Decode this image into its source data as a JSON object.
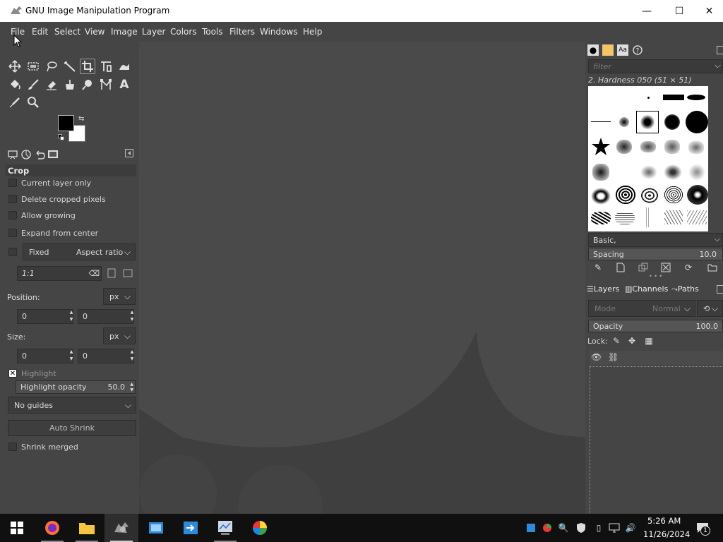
{
  "window": {
    "title": "GNU Image Manipulation Program",
    "minimize": "—",
    "maximize": "☐",
    "close": "✕"
  },
  "menubar": {
    "items": [
      "File",
      "Edit",
      "Select",
      "View",
      "Image",
      "Layer",
      "Colors",
      "Tools",
      "Filters",
      "Windows",
      "Help"
    ]
  },
  "tool_options": {
    "title": "Crop",
    "current_layer_only": "Current layer only",
    "delete_cropped": "Delete cropped pixels",
    "allow_growing": "Allow growing",
    "expand_from_center": "Expand from center",
    "fixed_label": "Fixed",
    "fixed_mode": "Aspect ratio",
    "ratio_value": "1:1",
    "position_label": "Position:",
    "position_unit": "px",
    "position_x": "0",
    "position_y": "0",
    "size_label": "Size:",
    "size_unit": "px",
    "size_w": "0",
    "size_h": "0",
    "highlight": "Highlight",
    "highlight_opacity_label": "Highlight opacity",
    "highlight_opacity_value": "50.0",
    "guides": "No guides",
    "auto_shrink": "Auto Shrink",
    "shrink_merged": "Shrink merged"
  },
  "brushes": {
    "filter_placeholder": "filter",
    "selected_brush": "2. Hardness 050 (51 × 51)",
    "tag": "Basic,",
    "spacing_label": "Spacing",
    "spacing_value": "10.0"
  },
  "layers": {
    "tab_layers": "Layers",
    "tab_channels": "Channels",
    "tab_paths": "Paths",
    "mode_label": "Mode",
    "mode_value": "Normal",
    "opacity_label": "Opacity",
    "opacity_value": "100.0",
    "lock_label": "Lock:"
  },
  "taskbar": {
    "time": "5:26 AM",
    "date": "11/26/2024",
    "notification_count": "1"
  },
  "colors": {
    "accent": "#454545",
    "foreground": "#000000",
    "background": "#ffffff"
  }
}
